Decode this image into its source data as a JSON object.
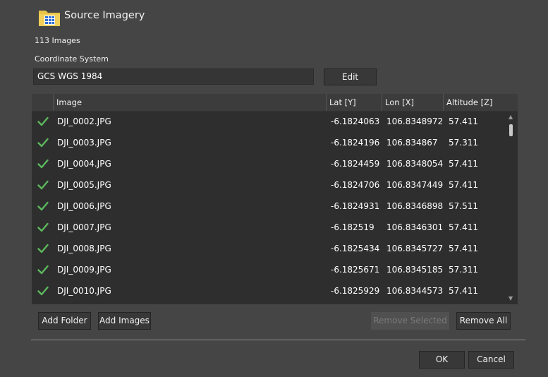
{
  "dialog": {
    "title": "Source Imagery",
    "image_count": "113 Images"
  },
  "coordinate_system": {
    "label": "Coordinate System",
    "value": "GCS WGS 1984",
    "edit_label": "Edit"
  },
  "table": {
    "columns": [
      "Image",
      "Lat [Y]",
      "Lon [X]",
      "Altitude [Z]"
    ],
    "rows": [
      {
        "status": "check-icon",
        "image": "DJI_0002.JPG",
        "lat": "-6.1824063",
        "lon": "106.8348972",
        "alt": "57.411"
      },
      {
        "status": "check-icon",
        "image": "DJI_0003.JPG",
        "lat": "-6.1824196",
        "lon": "106.834867",
        "alt": "57.311"
      },
      {
        "status": "check-icon",
        "image": "DJI_0004.JPG",
        "lat": "-6.1824459",
        "lon": "106.8348054",
        "alt": "57.411"
      },
      {
        "status": "check-icon",
        "image": "DJI_0005.JPG",
        "lat": "-6.1824706",
        "lon": "106.8347449",
        "alt": "57.411"
      },
      {
        "status": "check-icon",
        "image": "DJI_0006.JPG",
        "lat": "-6.1824931",
        "lon": "106.8346898",
        "alt": "57.511"
      },
      {
        "status": "check-icon",
        "image": "DJI_0007.JPG",
        "lat": "-6.182519",
        "lon": "106.8346301",
        "alt": "57.411"
      },
      {
        "status": "check-icon",
        "image": "DJI_0008.JPG",
        "lat": "-6.1825434",
        "lon": "106.8345727",
        "alt": "57.411"
      },
      {
        "status": "check-icon",
        "image": "DJI_0009.JPG",
        "lat": "-6.1825671",
        "lon": "106.8345185",
        "alt": "57.311"
      },
      {
        "status": "check-icon",
        "image": "DJI_0010.JPG",
        "lat": "-6.1825929",
        "lon": "106.8344573",
        "alt": "57.411"
      }
    ]
  },
  "buttons": {
    "add_folder": "Add Folder",
    "add_images": "Add Images",
    "remove_selected": "Remove Selected",
    "remove_all": "Remove All",
    "ok": "OK",
    "cancel": "Cancel"
  },
  "colors": {
    "background": "#454545",
    "table_bg": "#2e2e2e",
    "check_green": "#5cb85c",
    "folder_yellow": "#e8c447",
    "grid_blue": "#2f6fd6"
  }
}
